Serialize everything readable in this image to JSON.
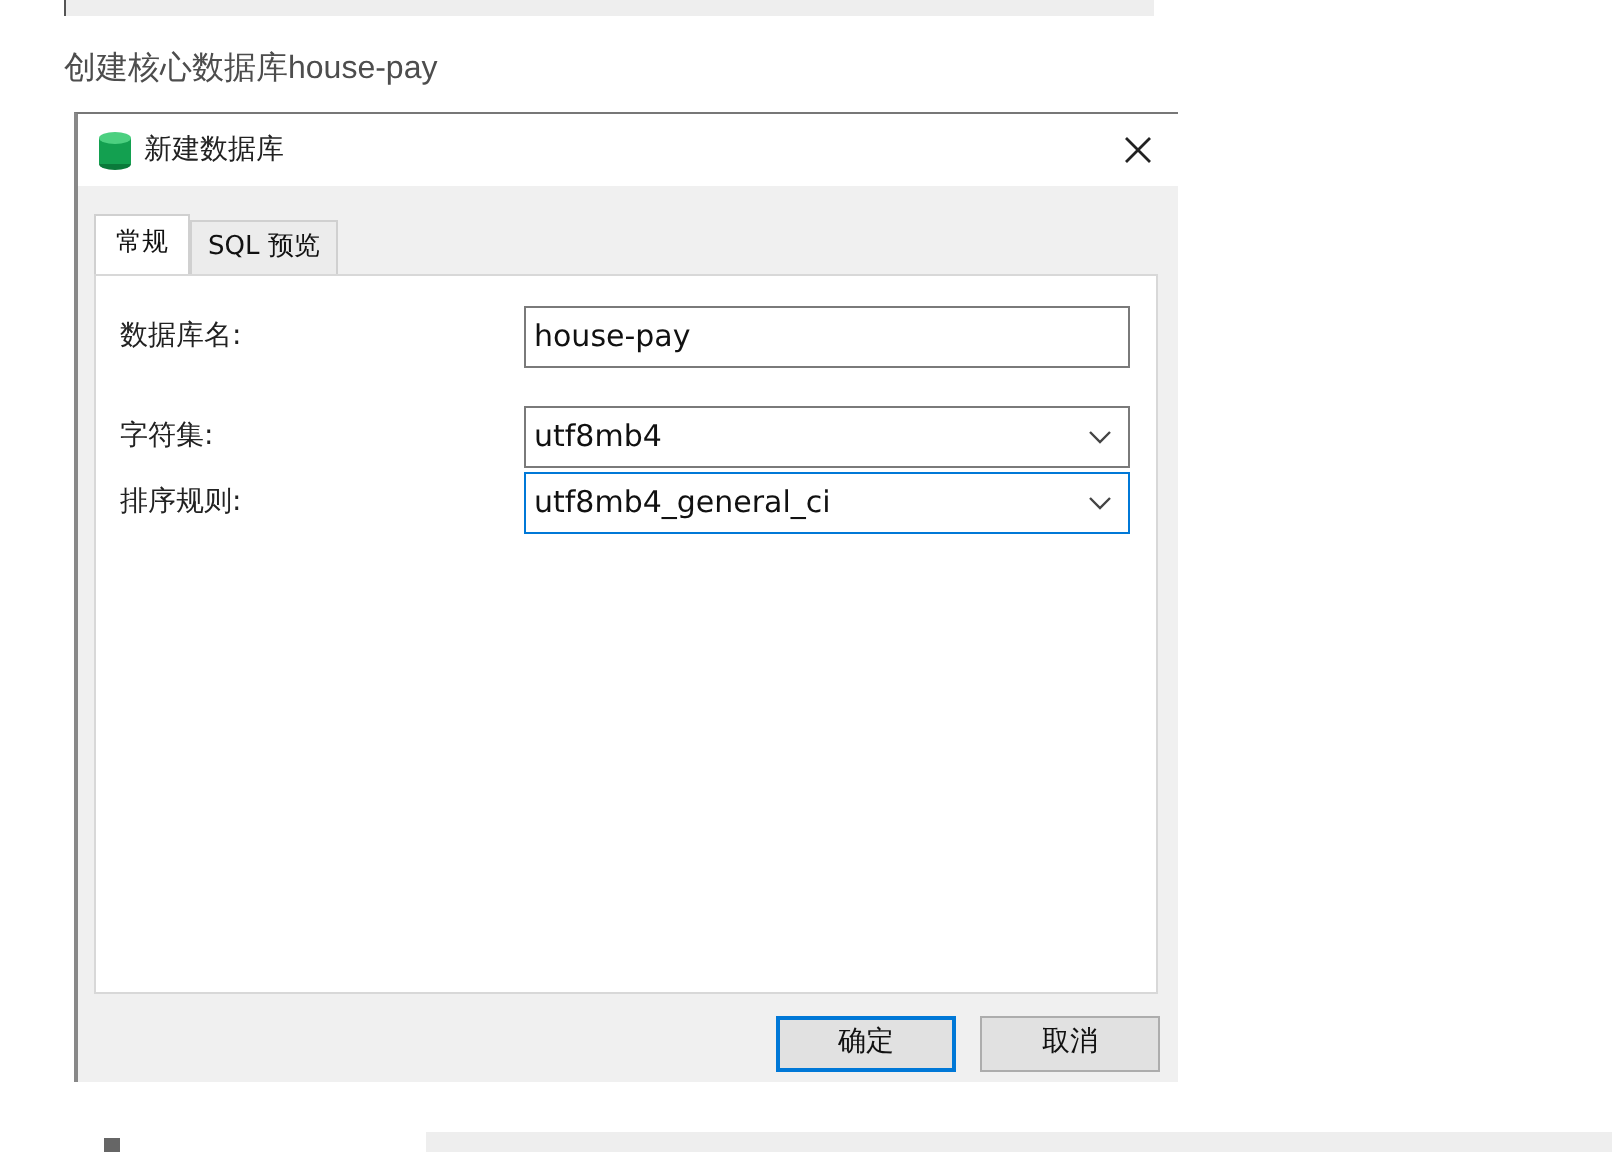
{
  "article": {
    "paragraph": "创建核心数据库house-pay"
  },
  "dialog": {
    "title": "新建数据库",
    "tabs": [
      {
        "label": "常规",
        "selected": true
      },
      {
        "label": "SQL 预览",
        "selected": false
      }
    ],
    "fields": [
      {
        "kind": "text",
        "label": "数据库名:",
        "value": "house-pay",
        "focused": false
      },
      {
        "kind": "select",
        "label": "字符集:",
        "value": "utf8mb4",
        "focused": false
      },
      {
        "kind": "select",
        "label": "排序规则:",
        "value": "utf8mb4_general_ci",
        "focused": true
      }
    ],
    "buttons": [
      {
        "label": "确定",
        "default": true
      },
      {
        "label": "取消",
        "default": false
      }
    ]
  }
}
